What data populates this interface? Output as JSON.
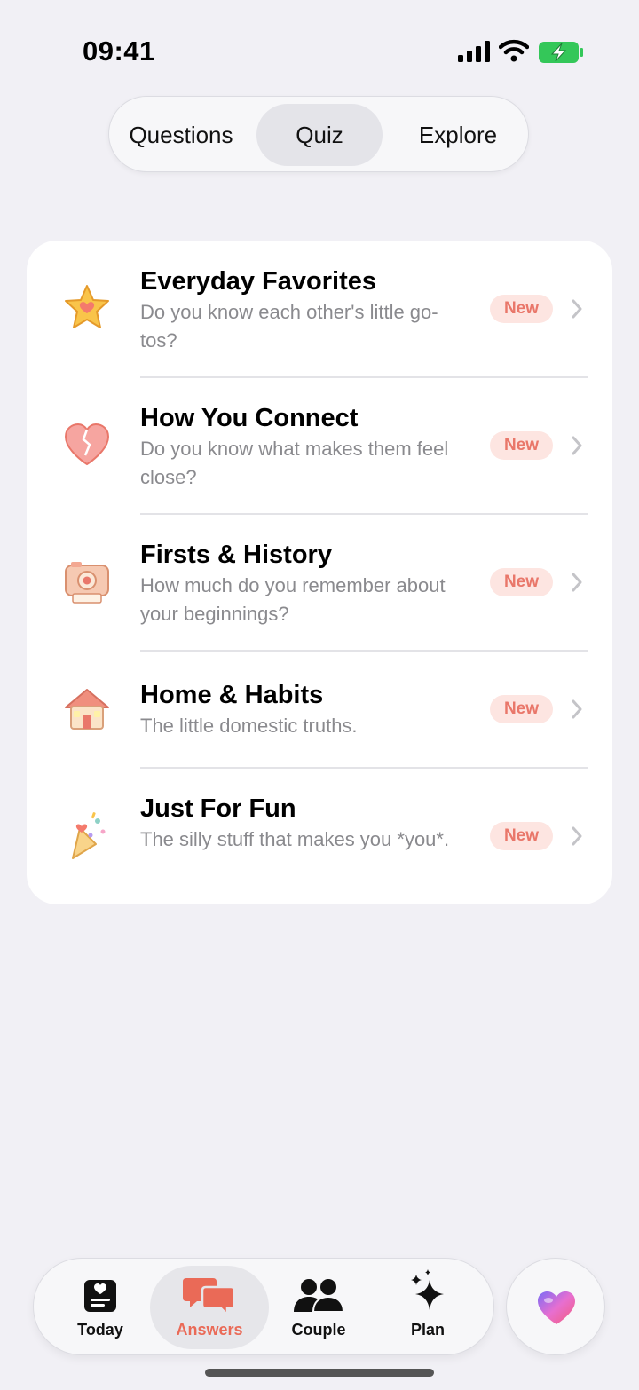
{
  "status_bar": {
    "time": "09:41"
  },
  "segmented": {
    "questions_label": "Questions",
    "quiz_label": "Quiz",
    "explore_label": "Explore",
    "selected": "Quiz"
  },
  "quizzes": [
    {
      "title": "Everyday Favorites",
      "subtitle": "Do you know each other's little go-tos?",
      "badge": "New",
      "icon": "star-icon"
    },
    {
      "title": "How You Connect",
      "subtitle": "Do you know what makes them feel close?",
      "badge": "New",
      "icon": "heart-icon"
    },
    {
      "title": "Firsts & History",
      "subtitle": "How much do you remember about your beginnings?",
      "badge": "New",
      "icon": "camera-icon"
    },
    {
      "title": "Home & Habits",
      "subtitle": "The little domestic truths.",
      "badge": "New",
      "icon": "house-icon"
    },
    {
      "title": "Just For Fun",
      "subtitle": "The silly stuff that makes you *you*.",
      "badge": "New",
      "icon": "party-popper-icon"
    }
  ],
  "tabbar": {
    "today_label": "Today",
    "answers_label": "Answers",
    "couple_label": "Couple",
    "plan_label": "Plan",
    "selected": "Answers"
  },
  "colors": {
    "accent": "#ea6a57",
    "badge_bg": "#fde5e1",
    "background": "#f1f0f5",
    "battery": "#34c759"
  }
}
